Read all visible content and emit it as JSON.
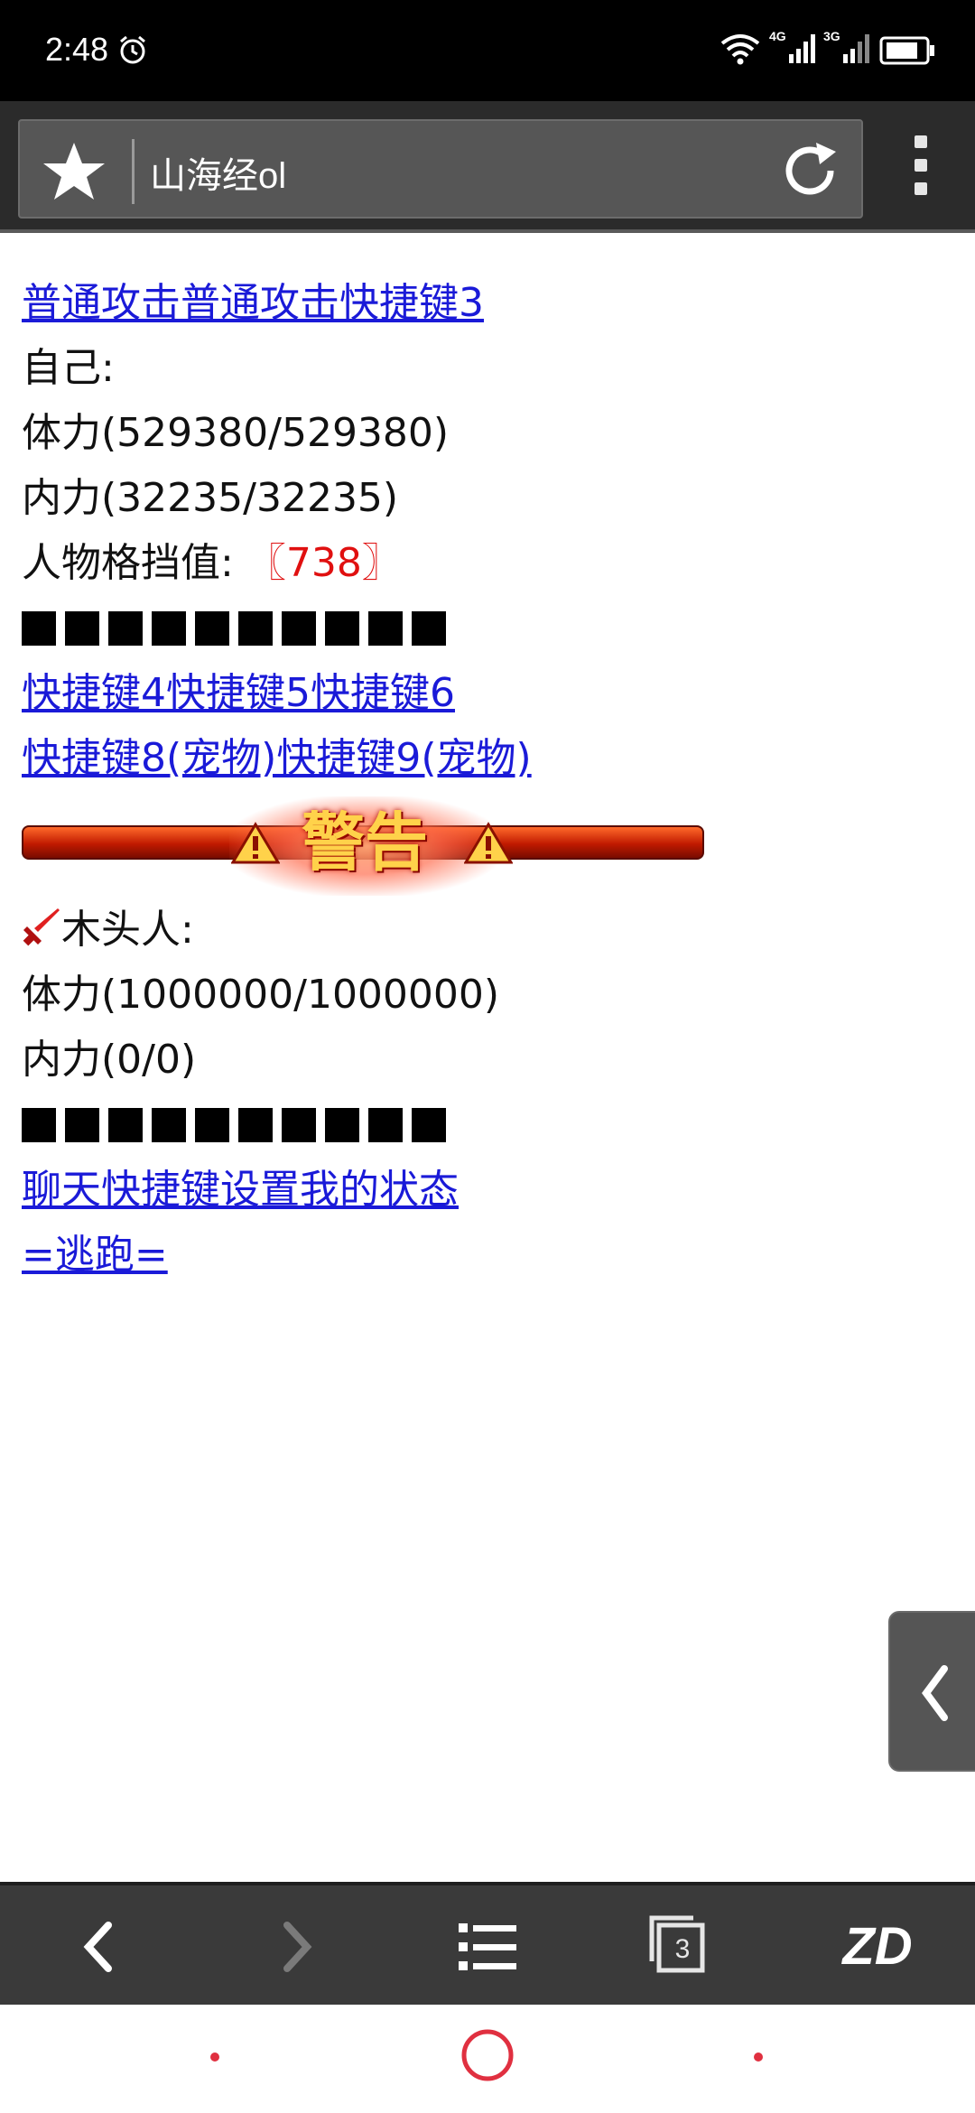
{
  "status_bar": {
    "time": "2:48",
    "net1": "4G",
    "net2": "3G"
  },
  "browser": {
    "page_title": "山海经ol",
    "tab_count": "3",
    "brand_button_label": "ZD"
  },
  "content": {
    "attack_links": "普通攻击普通攻击快捷键3",
    "self_label": "自己:",
    "self_hp": "体力(529380/529380)",
    "self_mp": "内力(32235/32235)",
    "block_label": "人物格挡值:",
    "block_value": "〖738〗",
    "hotkeys_row1": "快捷键4快捷键5快捷键6",
    "hotkeys_row2": "快捷键8(宠物)快捷键9(宠物)",
    "warning_text": "警告",
    "enemy_name": "木头人:",
    "enemy_hp": "体力(1000000/1000000)",
    "enemy_mp": "内力(0/0)",
    "chat_links": "聊天快捷键设置我的状态",
    "flee_link": "=逃跑="
  },
  "colors": {
    "link": "#1a1ad8",
    "highlight_red": "#e01010",
    "toolbar_bg": "#3a3a3a",
    "nav_accent": "#e03040"
  }
}
